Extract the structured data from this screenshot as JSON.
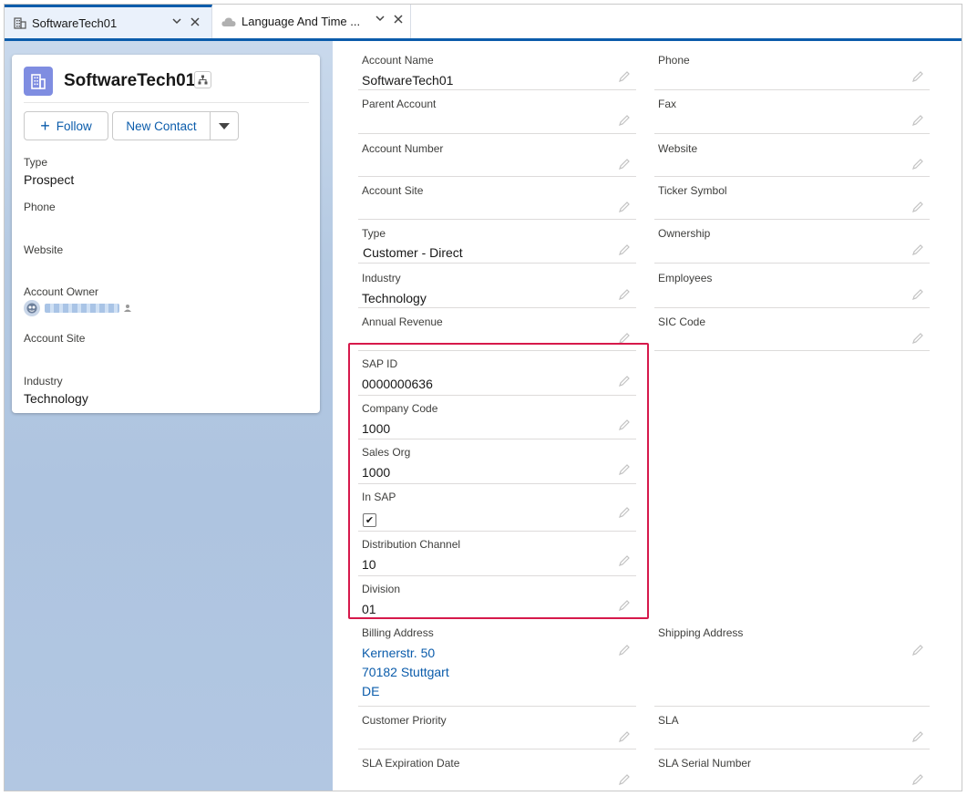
{
  "tabs": [
    {
      "label": "SoftwareTech01",
      "icon": "account-icon",
      "active": true
    },
    {
      "label": "Language And Time ...",
      "icon": "cloud-icon",
      "active": false
    }
  ],
  "highlights": {
    "title": "SoftwareTech01",
    "follow_label": "Follow",
    "new_contact_label": "New Contact",
    "fields": {
      "type_label": "Type",
      "type_value": "Prospect",
      "phone_label": "Phone",
      "website_label": "Website",
      "owner_label": "Account Owner",
      "site_label": "Account Site",
      "industry_label": "Industry",
      "industry_value": "Technology"
    }
  },
  "details": {
    "account_name": {
      "label": "Account Name",
      "value": "SoftwareTech01"
    },
    "phone": {
      "label": "Phone",
      "value": ""
    },
    "parent_account": {
      "label": "Parent Account",
      "value": ""
    },
    "fax": {
      "label": "Fax",
      "value": ""
    },
    "account_number": {
      "label": "Account Number",
      "value": ""
    },
    "website": {
      "label": "Website",
      "value": ""
    },
    "account_site": {
      "label": "Account Site",
      "value": ""
    },
    "ticker_symbol": {
      "label": "Ticker Symbol",
      "value": ""
    },
    "type": {
      "label": "Type",
      "value": "Customer - Direct"
    },
    "ownership": {
      "label": "Ownership",
      "value": ""
    },
    "industry": {
      "label": "Industry",
      "value": "Technology"
    },
    "employees": {
      "label": "Employees",
      "value": ""
    },
    "annual_revenue": {
      "label": "Annual Revenue",
      "value": ""
    },
    "sic_code": {
      "label": "SIC Code",
      "value": ""
    },
    "sap_id": {
      "label": "SAP ID",
      "value": "0000000636"
    },
    "company_code": {
      "label": "Company Code",
      "value": "1000"
    },
    "sales_org": {
      "label": "Sales Org",
      "value": "1000"
    },
    "in_sap": {
      "label": "In SAP",
      "checked": true,
      "check_glyph": "✔"
    },
    "distribution_channel": {
      "label": "Distribution Channel",
      "value": "10"
    },
    "division": {
      "label": "Division",
      "value": "01"
    },
    "billing_address": {
      "label": "Billing Address",
      "line1": "Kernerstr. 50",
      "line2": "70182 Stuttgart",
      "line3": "DE"
    },
    "shipping_address": {
      "label": "Shipping Address",
      "value": ""
    },
    "customer_priority": {
      "label": "Customer Priority",
      "value": ""
    },
    "sla": {
      "label": "SLA",
      "value": ""
    },
    "sla_expiration_date": {
      "label": "SLA Expiration Date",
      "value": ""
    },
    "sla_serial_number": {
      "label": "SLA Serial Number",
      "value": ""
    }
  },
  "colors": {
    "brand_blue": "#0b5cab",
    "highlight_border": "#d6194b",
    "account_icon_bg": "#7f8de1"
  }
}
